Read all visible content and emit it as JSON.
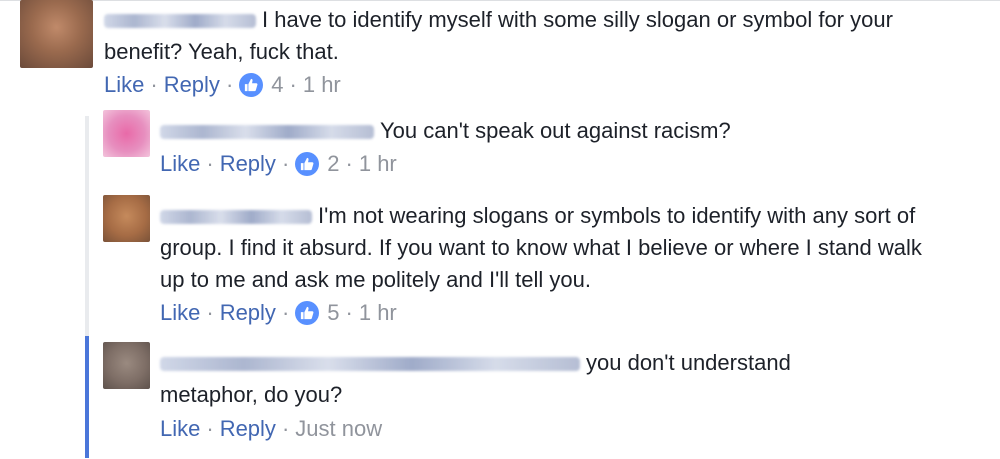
{
  "colors": {
    "link": "#4267b2",
    "meta": "#90949c",
    "text": "#1d2129",
    "like_badge": "#5890ff",
    "active_thread": "#4a76d9"
  },
  "comments": [
    {
      "text": "I have to identify myself with some silly slogan or symbol for your benefit? Yeah, fuck that.",
      "like": "Like",
      "reply": "Reply",
      "reactions": "4",
      "time": "1 hr"
    },
    {
      "text": "You can't speak out against racism?",
      "like": "Like",
      "reply": "Reply",
      "reactions": "2",
      "time": "1 hr"
    },
    {
      "text": "I'm not wearing slogans or symbols to identify with any sort of group. I find it absurd. If you want to know what I believe or where I stand walk up to me and ask me politely and I'll tell you.",
      "like": "Like",
      "reply": "Reply",
      "reactions": "5",
      "time": "1 hr"
    },
    {
      "text": "you don't understand metaphor, do you?",
      "like": "Like",
      "reply": "Reply",
      "time": "Just now"
    }
  ]
}
